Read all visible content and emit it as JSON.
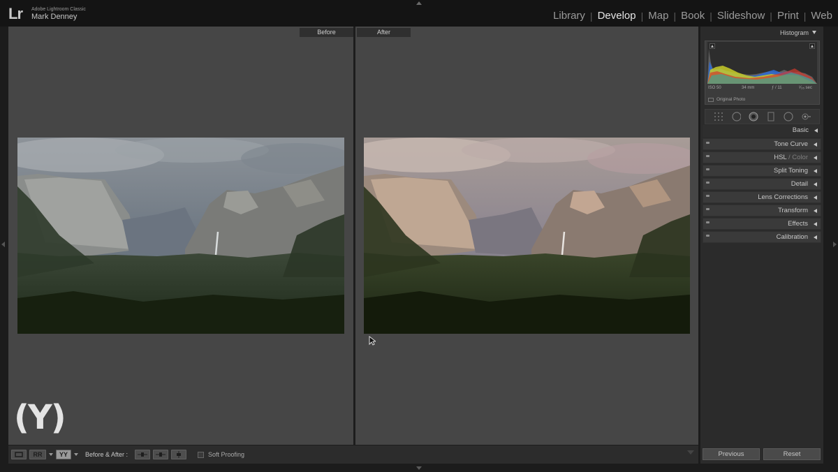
{
  "identity": {
    "logo": "Lr",
    "app_name": "Adobe Lightroom Classic",
    "user_name": "Mark Denney"
  },
  "modules": [
    {
      "label": "Library",
      "active": false
    },
    {
      "label": "Develop",
      "active": true
    },
    {
      "label": "Map",
      "active": false
    },
    {
      "label": "Book",
      "active": false
    },
    {
      "label": "Slideshow",
      "active": false
    },
    {
      "label": "Print",
      "active": false
    },
    {
      "label": "Web",
      "active": false
    }
  ],
  "view": {
    "before_label": "Before",
    "after_label": "After",
    "shortcut_badge": "(Y)"
  },
  "toolbar": {
    "view_mode_loupe": "",
    "view_mode_compare": "RR",
    "view_mode_before_after": "YY",
    "before_after_label": "Before & After :",
    "soft_proofing_label": "Soft Proofing"
  },
  "histogram": {
    "title": "Histogram",
    "iso": "ISO 50",
    "focal_length": "34 mm",
    "aperture": "ƒ / 11",
    "shutter": "¹⁄₃₅ sec",
    "original_photo_label": "Original Photo"
  },
  "panels": [
    {
      "label": "Basic"
    },
    {
      "label": "Tone Curve"
    },
    {
      "label": "HSL",
      "dim_suffix": " / Color"
    },
    {
      "label": "Split Toning"
    },
    {
      "label": "Detail"
    },
    {
      "label": "Lens Corrections"
    },
    {
      "label": "Transform"
    },
    {
      "label": "Effects"
    },
    {
      "label": "Calibration"
    }
  ],
  "buttons": {
    "previous": "Previous",
    "reset": "Reset"
  },
  "colors": {
    "chrome_dark": "#141414",
    "view_bg": "#464646",
    "panel_bg": "#2b2b2b",
    "active_module": "#e6e6e6"
  }
}
